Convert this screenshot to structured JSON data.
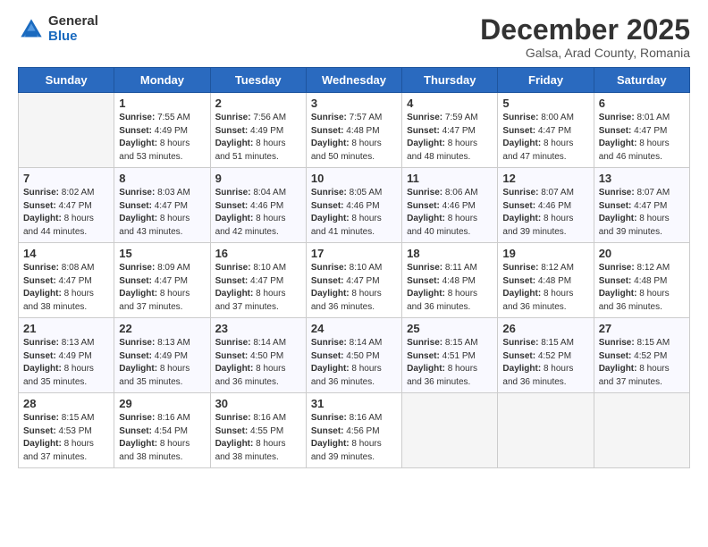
{
  "logo": {
    "general": "General",
    "blue": "Blue"
  },
  "title": "December 2025",
  "subtitle": "Galsa, Arad County, Romania",
  "days_of_week": [
    "Sunday",
    "Monday",
    "Tuesday",
    "Wednesday",
    "Thursday",
    "Friday",
    "Saturday"
  ],
  "weeks": [
    [
      {
        "day": "",
        "info": ""
      },
      {
        "day": "1",
        "info": "Sunrise: 7:55 AM\nSunset: 4:49 PM\nDaylight: 8 hours\nand 53 minutes."
      },
      {
        "day": "2",
        "info": "Sunrise: 7:56 AM\nSunset: 4:49 PM\nDaylight: 8 hours\nand 51 minutes."
      },
      {
        "day": "3",
        "info": "Sunrise: 7:57 AM\nSunset: 4:48 PM\nDaylight: 8 hours\nand 50 minutes."
      },
      {
        "day": "4",
        "info": "Sunrise: 7:59 AM\nSunset: 4:47 PM\nDaylight: 8 hours\nand 48 minutes."
      },
      {
        "day": "5",
        "info": "Sunrise: 8:00 AM\nSunset: 4:47 PM\nDaylight: 8 hours\nand 47 minutes."
      },
      {
        "day": "6",
        "info": "Sunrise: 8:01 AM\nSunset: 4:47 PM\nDaylight: 8 hours\nand 46 minutes."
      }
    ],
    [
      {
        "day": "7",
        "info": "Sunrise: 8:02 AM\nSunset: 4:47 PM\nDaylight: 8 hours\nand 44 minutes."
      },
      {
        "day": "8",
        "info": "Sunrise: 8:03 AM\nSunset: 4:47 PM\nDaylight: 8 hours\nand 43 minutes."
      },
      {
        "day": "9",
        "info": "Sunrise: 8:04 AM\nSunset: 4:46 PM\nDaylight: 8 hours\nand 42 minutes."
      },
      {
        "day": "10",
        "info": "Sunrise: 8:05 AM\nSunset: 4:46 PM\nDaylight: 8 hours\nand 41 minutes."
      },
      {
        "day": "11",
        "info": "Sunrise: 8:06 AM\nSunset: 4:46 PM\nDaylight: 8 hours\nand 40 minutes."
      },
      {
        "day": "12",
        "info": "Sunrise: 8:07 AM\nSunset: 4:46 PM\nDaylight: 8 hours\nand 39 minutes."
      },
      {
        "day": "13",
        "info": "Sunrise: 8:07 AM\nSunset: 4:47 PM\nDaylight: 8 hours\nand 39 minutes."
      }
    ],
    [
      {
        "day": "14",
        "info": "Sunrise: 8:08 AM\nSunset: 4:47 PM\nDaylight: 8 hours\nand 38 minutes."
      },
      {
        "day": "15",
        "info": "Sunrise: 8:09 AM\nSunset: 4:47 PM\nDaylight: 8 hours\nand 37 minutes."
      },
      {
        "day": "16",
        "info": "Sunrise: 8:10 AM\nSunset: 4:47 PM\nDaylight: 8 hours\nand 37 minutes."
      },
      {
        "day": "17",
        "info": "Sunrise: 8:10 AM\nSunset: 4:47 PM\nDaylight: 8 hours\nand 36 minutes."
      },
      {
        "day": "18",
        "info": "Sunrise: 8:11 AM\nSunset: 4:48 PM\nDaylight: 8 hours\nand 36 minutes."
      },
      {
        "day": "19",
        "info": "Sunrise: 8:12 AM\nSunset: 4:48 PM\nDaylight: 8 hours\nand 36 minutes."
      },
      {
        "day": "20",
        "info": "Sunrise: 8:12 AM\nSunset: 4:48 PM\nDaylight: 8 hours\nand 36 minutes."
      }
    ],
    [
      {
        "day": "21",
        "info": "Sunrise: 8:13 AM\nSunset: 4:49 PM\nDaylight: 8 hours\nand 35 minutes."
      },
      {
        "day": "22",
        "info": "Sunrise: 8:13 AM\nSunset: 4:49 PM\nDaylight: 8 hours\nand 35 minutes."
      },
      {
        "day": "23",
        "info": "Sunrise: 8:14 AM\nSunset: 4:50 PM\nDaylight: 8 hours\nand 36 minutes."
      },
      {
        "day": "24",
        "info": "Sunrise: 8:14 AM\nSunset: 4:50 PM\nDaylight: 8 hours\nand 36 minutes."
      },
      {
        "day": "25",
        "info": "Sunrise: 8:15 AM\nSunset: 4:51 PM\nDaylight: 8 hours\nand 36 minutes."
      },
      {
        "day": "26",
        "info": "Sunrise: 8:15 AM\nSunset: 4:52 PM\nDaylight: 8 hours\nand 36 minutes."
      },
      {
        "day": "27",
        "info": "Sunrise: 8:15 AM\nSunset: 4:52 PM\nDaylight: 8 hours\nand 37 minutes."
      }
    ],
    [
      {
        "day": "28",
        "info": "Sunrise: 8:15 AM\nSunset: 4:53 PM\nDaylight: 8 hours\nand 37 minutes."
      },
      {
        "day": "29",
        "info": "Sunrise: 8:16 AM\nSunset: 4:54 PM\nDaylight: 8 hours\nand 38 minutes."
      },
      {
        "day": "30",
        "info": "Sunrise: 8:16 AM\nSunset: 4:55 PM\nDaylight: 8 hours\nand 38 minutes."
      },
      {
        "day": "31",
        "info": "Sunrise: 8:16 AM\nSunset: 4:56 PM\nDaylight: 8 hours\nand 39 minutes."
      },
      {
        "day": "",
        "info": ""
      },
      {
        "day": "",
        "info": ""
      },
      {
        "day": "",
        "info": ""
      }
    ]
  ]
}
